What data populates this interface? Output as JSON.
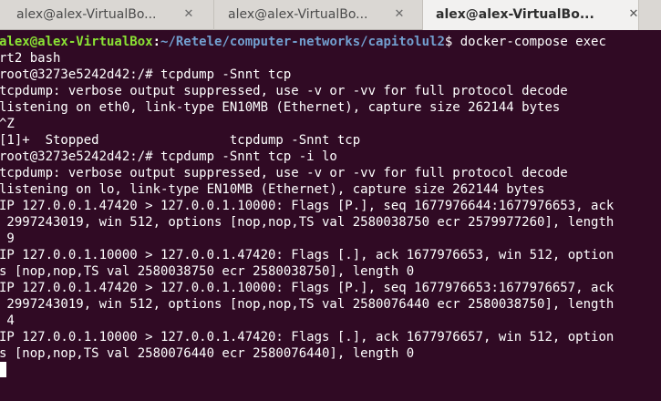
{
  "tabs": [
    {
      "label": "alex@alex-VirtualBo...",
      "active": false
    },
    {
      "label": "alex@alex-VirtualBo...",
      "active": false
    },
    {
      "label": "alex@alex-VirtualBo...",
      "active": true
    }
  ],
  "icons": {
    "close": "close-icon"
  },
  "terminal": {
    "prompt_user": "alex@alex-VirtualBox",
    "prompt_colon": ":",
    "prompt_path": "~/Retele/computer-networks/capitolul2",
    "prompt_end": "$ ",
    "first_command": "docker-compose exec",
    "lines": [
      "rt2 bash",
      "root@3273e5242d42:/# tcpdump -Snnt tcp",
      "tcpdump: verbose output suppressed, use -v or -vv for full protocol decode",
      "listening on eth0, link-type EN10MB (Ethernet), capture size 262144 bytes",
      "^Z",
      "[1]+  Stopped                 tcpdump -Snnt tcp",
      "root@3273e5242d42:/# tcpdump -Snnt tcp -i lo",
      "tcpdump: verbose output suppressed, use -v or -vv for full protocol decode",
      "listening on lo, link-type EN10MB (Ethernet), capture size 262144 bytes",
      "IP 127.0.0.1.47420 > 127.0.0.1.10000: Flags [P.], seq 1677976644:1677976653, ack",
      " 2997243019, win 512, options [nop,nop,TS val 2580038750 ecr 2579977260], length",
      " 9",
      "IP 127.0.0.1.10000 > 127.0.0.1.47420: Flags [.], ack 1677976653, win 512, option",
      "s [nop,nop,TS val 2580038750 ecr 2580038750], length 0",
      "IP 127.0.0.1.47420 > 127.0.0.1.10000: Flags [P.], seq 1677976653:1677976657, ack",
      " 2997243019, win 512, options [nop,nop,TS val 2580076440 ecr 2580038750], length",
      " 4",
      "IP 127.0.0.1.10000 > 127.0.0.1.47420: Flags [.], ack 1677976657, win 512, option",
      "s [nop,nop,TS val 2580076440 ecr 2580076440], length 0"
    ]
  },
  "colors": {
    "background": "#300a24",
    "prompt_user": "#8ae234",
    "prompt_path": "#729fcf",
    "text": "#ffffff",
    "tabbar": "#dad7d3",
    "active_tab": "#f2f1f0"
  }
}
